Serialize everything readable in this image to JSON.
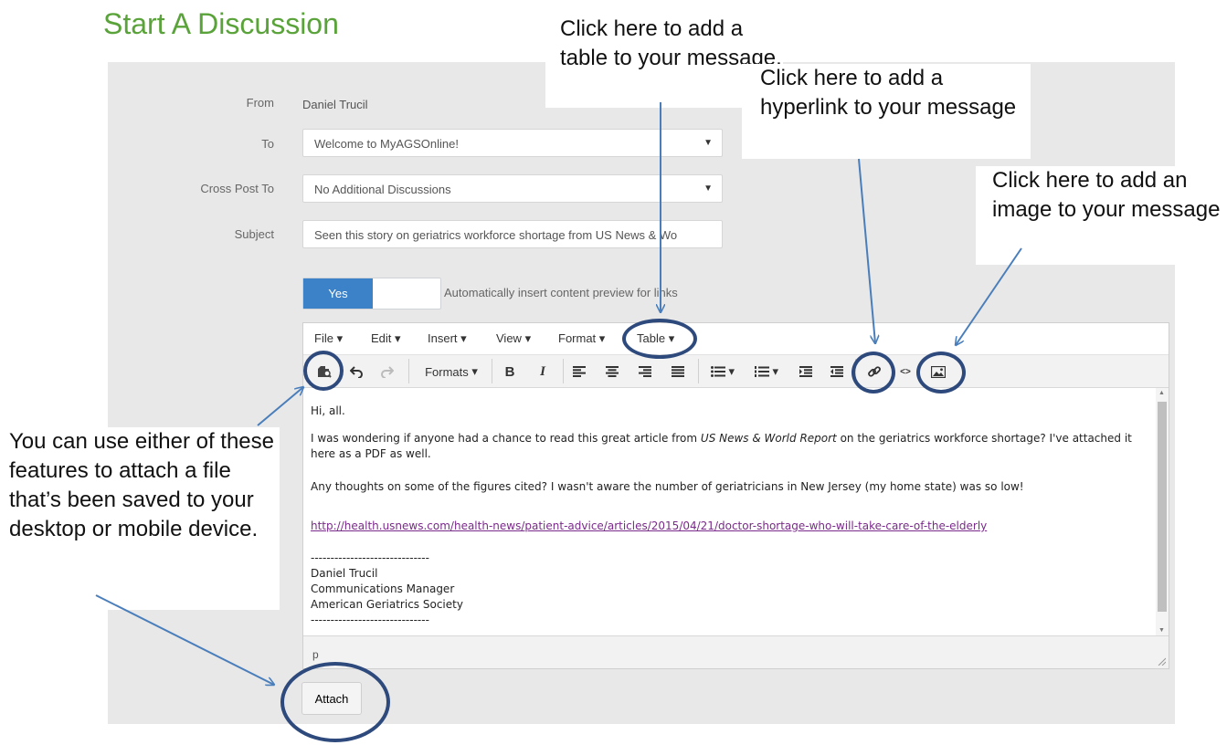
{
  "page_title": "Start A Discussion",
  "form": {
    "from_label": "From",
    "from_value": "Daniel Trucil",
    "to_label": "To",
    "to_value": "Welcome to MyAGSOnline!",
    "cross_post_label": "Cross Post To",
    "cross_post_value": "No Additional Discussions",
    "subject_label": "Subject",
    "subject_value": "Seen this story on geriatrics workforce shortage from US News & Wo",
    "toggle_label": "Yes",
    "toggle_on": true,
    "auto_preview_text": "Automatically insert content preview for links"
  },
  "editor": {
    "menus": [
      "File",
      "Edit",
      "Insert",
      "View",
      "Format",
      "Table"
    ],
    "formats_label": "Formats",
    "toolbar_icons": [
      "attach-file-icon",
      "undo-icon",
      "redo-icon",
      "bold-icon",
      "italic-icon",
      "align-left-icon",
      "align-center-icon",
      "align-right-icon",
      "align-justify-icon",
      "bullet-list-icon",
      "numbered-list-icon",
      "outdent-icon",
      "indent-icon",
      "link-icon",
      "source-code-icon",
      "image-icon"
    ],
    "bold_glyph": "B",
    "italic_glyph": "I",
    "source_glyph": "<>",
    "body": {
      "greeting": "Hi, all.",
      "p1_pre": "I was wondering if anyone had a chance to read this great article from ",
      "p1_em": "US News & World Report",
      "p1_post": " on the geriatrics workforce shortage?  I've attached it here as a PDF as well.",
      "p2": "Any thoughts on some of the figures cited?  I wasn't aware the number of geriatricians in New Jersey (my home state) was so low!",
      "link": "http://health.usnews.com/health-news/patient-advice/articles/2015/04/21/doctor-shortage-who-will-take-care-of-the-elderly",
      "sig_rule": "------------------------------",
      "sig_name": "Daniel Trucil",
      "sig_title": "Communications Manager",
      "sig_org": "American Geriatrics Society",
      "sig_rule_end": "------------------------------"
    },
    "status_path": "p"
  },
  "attach_label": "Attach",
  "callouts": {
    "table": "Click here to add a table to your message.",
    "hyperlink": "Click here to add a hyperlink to your message",
    "image": "Click here to add an image to your message",
    "attach": "You can use either of these features to attach a file that’s been saved to your desktop or mobile device."
  },
  "colors": {
    "title_green": "#5aa33a",
    "toggle_blue": "#3b82c9",
    "ring_navy": "#2e4a7d",
    "arrow_blue": "#4a7ebb",
    "link_purple": "#7a2a8a"
  }
}
